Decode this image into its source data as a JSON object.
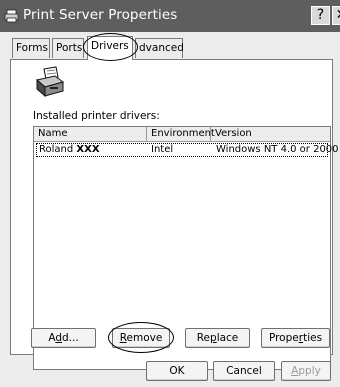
{
  "window": {
    "title": "Print Server Properties",
    "help_button": "?",
    "close_button": "✕"
  },
  "tabs": [
    {
      "label": "Forms"
    },
    {
      "label": "Ports"
    },
    {
      "label": "Drivers"
    },
    {
      "label": "dvanced"
    }
  ],
  "drivers": {
    "installed_label": "Installed printer drivers:",
    "columns": [
      "Name",
      "Environment",
      "Version"
    ],
    "rows": [
      {
        "name_prefix": "Roland",
        "name_suffix": "XXX",
        "environment": "Intel",
        "version": "Windows NT 4.0 or 2000"
      }
    ]
  },
  "action_buttons": {
    "add": {
      "pre": "A",
      "accel": "d",
      "post": "d..."
    },
    "remove": {
      "pre": "",
      "accel": "R",
      "post": "emove"
    },
    "replace": {
      "pre": "Re",
      "accel": "p",
      "post": "lace"
    },
    "properties": {
      "pre": "Prope",
      "accel": "r",
      "post": "ties"
    }
  },
  "dialog_buttons": {
    "ok": "OK",
    "cancel": "Cancel",
    "apply": {
      "pre": "",
      "accel": "A",
      "post": "pply"
    }
  }
}
